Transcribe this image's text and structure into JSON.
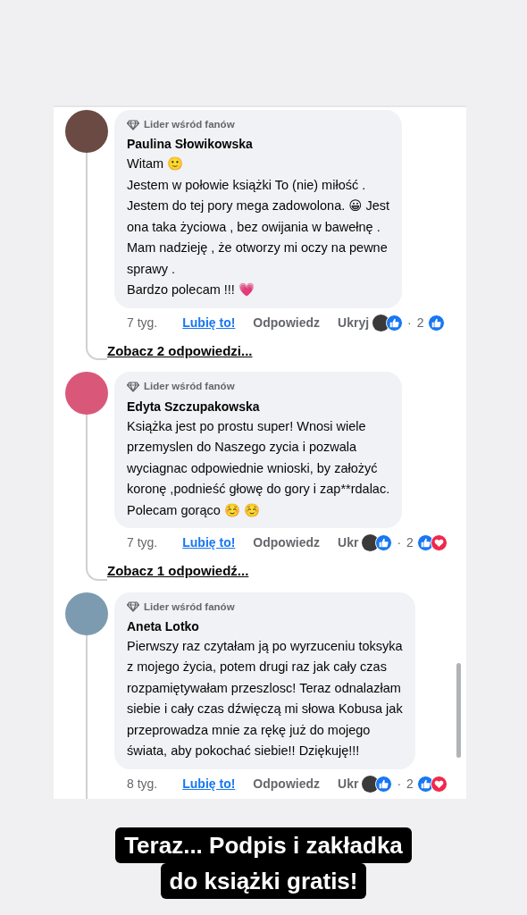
{
  "comments": [
    {
      "badge": "Lider wśród fanów",
      "author": "Paulina Słowikowska",
      "body": "Witam 🙂\nJestem w połowie książki  To (nie) miłość .\nJestem do tej pory mega zadowolona.  😀 Jest\nona taka życiowa , bez owijania w bawełnę .\nMam nadzieję , że otworzy mi oczy na pewne\nsprawy .\nBardzo polecam !!! 💗",
      "time": "7 tyg.",
      "like": "Lubię to!",
      "liked": true,
      "reply": "Odpowiedz",
      "hide": "Ukryj",
      "separator": "·",
      "reaction_count": "2",
      "reactions": [
        {
          "kind": "like"
        }
      ],
      "replies_link": "Zobacz 2 odpowiedzi..."
    },
    {
      "badge": "Lider wśród fanów",
      "author": "Edyta Szczupakowska",
      "body": "Książka jest po prostu super! Wnosi wiele\nprzemyslen do Naszego zycia i pozwala\nwyciagnac odpowiednie wnioski, by założyć\nkoronę ,podnieść głowę do gory i zap**rdalac.\nPolecam gorąco ☺️ ☺️",
      "time": "7 tyg.",
      "like": "Lubię to!",
      "liked": true,
      "reply": "Odpowiedz",
      "hide": "Ukr",
      "separator": "·",
      "reaction_count": "2",
      "reactions": [
        {
          "kind": "like"
        },
        {
          "kind": "love"
        }
      ],
      "replies_link": "Zobacz 1 odpowiedź..."
    },
    {
      "badge": "Lider wśród fanów",
      "author": "Aneta Lotko",
      "body": "Pierwszy raz czytałam ją po wyrzuceniu toksyka\nz mojego życia, potem drugi raz jak cały czas\nrozpamiętywałam przeszlosc! Teraz odnalazłam\nsiebie i cały czas dźwięczą mi słowa Kobusa jak\nprzeprowadza mnie za rękę już do mojego\nświata, aby pokochać siebie!! Dziękuję!!!",
      "time": "8 tyg.",
      "like": "Lubię to!",
      "liked": true,
      "reply": "Odpowiedz",
      "hide": "Ukr",
      "separator": "·",
      "reaction_count": "2",
      "reactions": [
        {
          "kind": "like"
        },
        {
          "kind": "love"
        }
      ]
    }
  ],
  "caption_lines": [
    "Teraz... Podpis i zakładka",
    "do książki gratis!"
  ]
}
